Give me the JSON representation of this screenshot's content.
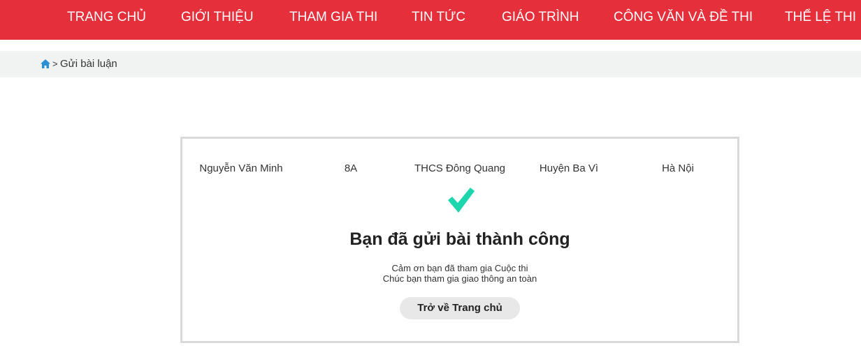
{
  "nav": {
    "items": [
      "TRANG CHỦ",
      "GIỚI THIỆU",
      "THAM GIA THI",
      "TIN TỨC",
      "GIÁO TRÌNH",
      "CÔNG VĂN VÀ ĐỀ THI",
      "THỂ LỆ THI"
    ],
    "background_color": "#e52f3a"
  },
  "breadcrumb": {
    "home_icon": "home-icon",
    "separator": ">",
    "current": "Gửi bài luận"
  },
  "submission": {
    "name": "Nguyễn Văn Minh",
    "class": "8A",
    "school": "THCS Đông Quang",
    "district": "Huyện Ba Vì",
    "city": "Hà Nội"
  },
  "result": {
    "icon": "checkmark-icon",
    "icon_color": "#1ed6ae",
    "title": "Bạn đã gửi bài thành công",
    "message_line1": "Cảm ơn bạn đã tham gia Cuộc thi",
    "message_line2": "Chúc bạn tham gia giao thông an toàn",
    "button_label": "Trở về Trang chủ"
  }
}
